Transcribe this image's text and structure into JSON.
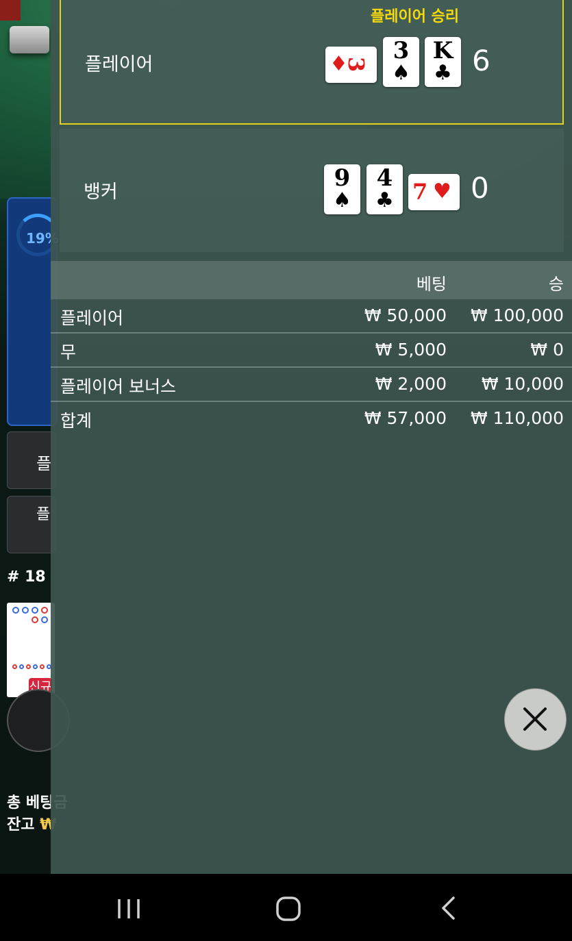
{
  "background": {
    "timer_percent": "19%",
    "side_button_1": "플",
    "side_button_2": "플",
    "round_number": "# 18",
    "new_badge": "신규",
    "total_bet_label": "총 베팅금",
    "balance_label": "잔고",
    "currency_symbol": "₩"
  },
  "result": {
    "win_label": "플레이어 승리",
    "player": {
      "name": "플레이어",
      "score": "6",
      "cards": [
        {
          "rank": "3",
          "suit": "♦",
          "color": "red",
          "orientation": "sideways"
        },
        {
          "rank": "3",
          "suit": "♠",
          "color": "black",
          "orientation": "upright"
        },
        {
          "rank": "K",
          "suit": "♣",
          "color": "black",
          "orientation": "upright"
        }
      ]
    },
    "banker": {
      "name": "뱅커",
      "score": "0",
      "cards": [
        {
          "rank": "9",
          "suit": "♠",
          "color": "black",
          "orientation": "upright"
        },
        {
          "rank": "4",
          "suit": "♣",
          "color": "black",
          "orientation": "upright"
        },
        {
          "rank": "7",
          "suit": "♥",
          "color": "red",
          "orientation": "sideways"
        }
      ]
    }
  },
  "bets": {
    "header_bet": "베팅",
    "header_win": "승",
    "rows": [
      {
        "label": "플레이어",
        "bet": "₩ 50,000",
        "win": "₩ 100,000"
      },
      {
        "label": "무",
        "bet": "₩ 5,000",
        "win": "₩ 0"
      },
      {
        "label": "플레이어 보너스",
        "bet": "₩ 2,000",
        "win": "₩ 10,000"
      }
    ],
    "total": {
      "label": "합계",
      "bet": "₩ 57,000",
      "win": "₩ 110,000"
    }
  },
  "colors": {
    "winner_border": "#e6d21a",
    "win_label": "#f5d90a",
    "overlay": "#3e5650"
  },
  "icons": {
    "close": "close-icon",
    "nav_recents": "recents-icon",
    "nav_home": "home-icon",
    "nav_back": "back-icon"
  }
}
